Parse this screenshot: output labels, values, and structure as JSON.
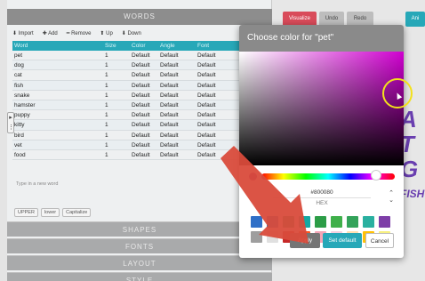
{
  "words_panel": {
    "title": "WORDS",
    "toolbar": [
      "Import",
      "Add",
      "Remove",
      "Up",
      "Down"
    ],
    "columns": [
      "Word",
      "Size",
      "Color",
      "Angle",
      "Font"
    ],
    "rows": [
      [
        "pet",
        "1",
        "Default",
        "Default",
        "Default"
      ],
      [
        "dog",
        "1",
        "Default",
        "Default",
        "Default"
      ],
      [
        "cat",
        "1",
        "Default",
        "Default",
        "Default"
      ],
      [
        "fish",
        "1",
        "Default",
        "Default",
        "Default"
      ],
      [
        "snake",
        "1",
        "Default",
        "Default",
        "Default"
      ],
      [
        "hamster",
        "1",
        "Default",
        "Default",
        "Default"
      ],
      [
        "puppy",
        "1",
        "Default",
        "Default",
        "Default"
      ],
      [
        "kitty",
        "1",
        "Default",
        "Default",
        "Default"
      ],
      [
        "bird",
        "1",
        "Default",
        "Default",
        "Default"
      ],
      [
        "vet",
        "1",
        "Default",
        "Default",
        "Default"
      ],
      [
        "food",
        "1",
        "Default",
        "Default",
        "Default"
      ]
    ],
    "type_hint": "Type in a new word",
    "case_buttons": [
      "UPPER",
      "lower",
      "Capitalize"
    ],
    "sections": [
      "SHAPES",
      "FONTS",
      "LAYOUT",
      "STYLE"
    ]
  },
  "top_buttons": {
    "visualize": "Visualize",
    "undo": "Undo",
    "redo": "Redo",
    "animate": "Ani"
  },
  "art_text": [
    "A",
    "T",
    "G",
    "FISH"
  ],
  "color_dialog": {
    "title": "Choose color for \"pet\"",
    "hex_value": "#800080",
    "mode": "HEX",
    "swatches": [
      "#2f6fc7",
      "#1f7fbf",
      "#1aa36c",
      "#14a9a3",
      "#2c9d47",
      "#3fb04a",
      "#33a35a",
      "#2ab0a0",
      "#7e3ea8",
      "#9e9e9e",
      "#e0e0e0",
      "#c62828",
      "#ff5722",
      "#f4a6b7",
      "#f3d1df",
      "#ffe0b2",
      "#ffc107",
      "#f7f080"
    ],
    "apply_label": "Apply",
    "set_default_label": "Set default",
    "cancel_label": "Cancel"
  },
  "colors": {
    "teal": "#27a8b8",
    "selected_hue": "#d000d0",
    "annotation_arrow": "#d94b3b"
  }
}
